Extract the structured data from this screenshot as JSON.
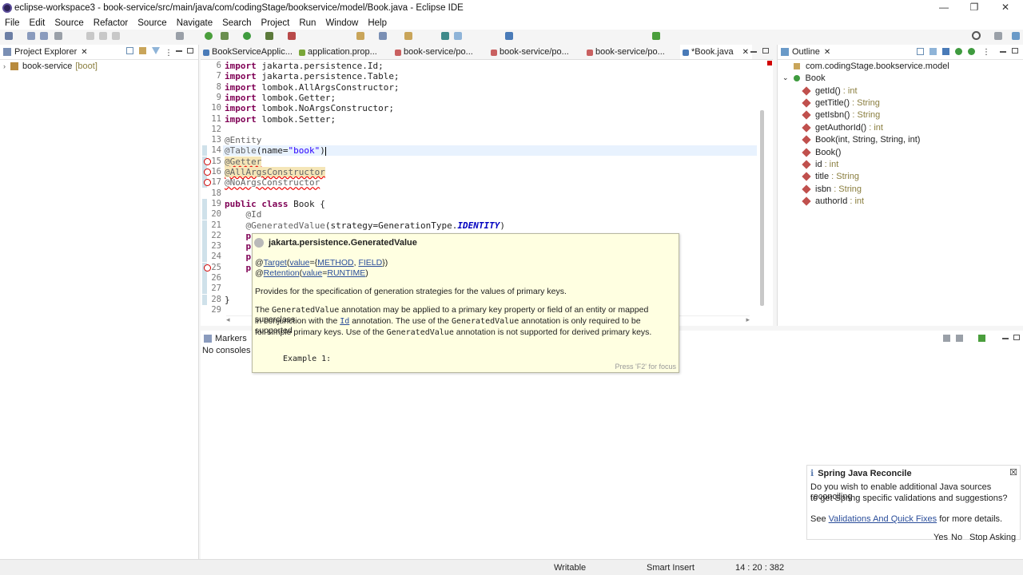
{
  "window": {
    "title": "eclipse-workspace3 - book-service/src/main/java/com/codingStage/bookservice/model/Book.java - Eclipse IDE",
    "minimize": "—",
    "maximize": "❐",
    "close": "✕"
  },
  "menu": [
    "File",
    "Edit",
    "Source",
    "Refactor",
    "Source",
    "Navigate",
    "Search",
    "Project",
    "Run",
    "Window",
    "Help"
  ],
  "project_explorer": {
    "tab": "Project Explorer",
    "project": "book-service",
    "project_tag": "[boot]"
  },
  "editor": {
    "tabs": [
      {
        "label": "BookServiceApplic...",
        "color": "#4a7bb8"
      },
      {
        "label": "application.prop...",
        "color": "#79a638"
      },
      {
        "label": "book-service/po...",
        "color": "#c96060"
      },
      {
        "label": "book-service/po...",
        "color": "#c96060"
      },
      {
        "label": "book-service/po...",
        "color": "#c96060"
      },
      {
        "label": "*Book.java",
        "color": "#4a7bb8"
      }
    ],
    "lines": [
      {
        "n": "6",
        "t": [
          {
            "k": "kw",
            "v": "import"
          },
          {
            "k": "",
            "v": " jakarta.persistence.Id;"
          }
        ]
      },
      {
        "n": "7",
        "t": [
          {
            "k": "kw",
            "v": "import"
          },
          {
            "k": "",
            "v": " jakarta.persistence.Table;"
          }
        ]
      },
      {
        "n": "8",
        "t": [
          {
            "k": "kw",
            "v": "import"
          },
          {
            "k": "",
            "v": " lombok.AllArgsConstructor;"
          }
        ]
      },
      {
        "n": "9",
        "t": [
          {
            "k": "kw",
            "v": "import"
          },
          {
            "k": "",
            "v": " lombok.Getter;"
          }
        ]
      },
      {
        "n": "10",
        "t": [
          {
            "k": "kw",
            "v": "import"
          },
          {
            "k": "",
            "v": " lombok.NoArgsConstructor;"
          }
        ]
      },
      {
        "n": "11",
        "t": [
          {
            "k": "kw",
            "v": "import"
          },
          {
            "k": "",
            "v": " lombok.Setter;"
          }
        ]
      },
      {
        "n": "12",
        "t": []
      },
      {
        "n": "13",
        "t": [
          {
            "k": "an",
            "v": "@Entity"
          }
        ]
      },
      {
        "n": "14",
        "t": [
          {
            "k": "an",
            "v": "@Table"
          },
          {
            "k": "",
            "v": "(name="
          },
          {
            "k": "str",
            "v": "\"book\""
          },
          {
            "k": "",
            "v": ")"
          }
        ]
      },
      {
        "n": "15",
        "t": [
          {
            "k": "an err warnbg",
            "v": "@Getter"
          }
        ]
      },
      {
        "n": "16",
        "t": [
          {
            "k": "an err warnbg",
            "v": "@AllArgsConstructor"
          }
        ]
      },
      {
        "n": "17",
        "t": [
          {
            "k": "an err",
            "v": "@NoArgsConstructor"
          }
        ]
      },
      {
        "n": "18",
        "t": []
      },
      {
        "n": "19",
        "t": [
          {
            "k": "kw",
            "v": "public"
          },
          {
            "k": "",
            "v": " "
          },
          {
            "k": "kw",
            "v": "class"
          },
          {
            "k": "",
            "v": " Book {"
          }
        ]
      },
      {
        "n": "20",
        "t": [
          {
            "k": "an",
            "v": "    @Id"
          }
        ]
      },
      {
        "n": "21",
        "t": [
          {
            "k": "an",
            "v": "    @GeneratedValue"
          },
          {
            "k": "",
            "v": "(strategy=GenerationType."
          },
          {
            "k": "ital",
            "v": "IDENTITY"
          },
          {
            "k": "",
            "v": ")"
          }
        ]
      },
      {
        "n": "22",
        "t": [
          {
            "k": "kw",
            "v": "    p"
          }
        ]
      },
      {
        "n": "23",
        "t": [
          {
            "k": "kw",
            "v": "    p"
          }
        ]
      },
      {
        "n": "24",
        "t": [
          {
            "k": "kw",
            "v": "    p"
          }
        ]
      },
      {
        "n": "25",
        "t": [
          {
            "k": "kw",
            "v": "    p"
          }
        ]
      },
      {
        "n": "26",
        "t": []
      },
      {
        "n": "27",
        "t": []
      },
      {
        "n": "28",
        "t": [
          {
            "k": "",
            "v": "}"
          }
        ]
      },
      {
        "n": "29",
        "t": []
      }
    ]
  },
  "outline": {
    "tab": "Outline",
    "package": "com.codingStage.bookservice.model",
    "class": "Book",
    "members": [
      {
        "name": "getId()",
        "type": ": int",
        "color": "#c0504d"
      },
      {
        "name": "getTitle()",
        "type": ": String",
        "color": "#c0504d"
      },
      {
        "name": "getIsbn()",
        "type": ": String",
        "color": "#c0504d"
      },
      {
        "name": "getAuthorId()",
        "type": ": int",
        "color": "#c0504d"
      },
      {
        "name": "Book(int, String, String, int)",
        "type": "",
        "color": "#c0504d"
      },
      {
        "name": "Book()",
        "type": "",
        "color": "#c0504d"
      },
      {
        "name": "id",
        "type": ": int",
        "color": "#c0504d"
      },
      {
        "name": "title",
        "type": ": String",
        "color": "#c0504d"
      },
      {
        "name": "isbn",
        "type": ": String",
        "color": "#c0504d"
      },
      {
        "name": "authorId",
        "type": ": int",
        "color": "#c0504d"
      }
    ]
  },
  "markers": {
    "tab": "Markers",
    "empty": "No consoles to"
  },
  "hover": {
    "title": "jakarta.persistence.GeneratedValue",
    "target_prefix": "@",
    "target": "Target",
    "target_args_open": "(",
    "target_value": "value",
    "target_eq": "={",
    "target_method": "METHOD",
    "target_sep": ", ",
    "target_field": "FIELD",
    "target_close": "})",
    "retention_prefix": "@",
    "retention": "Retention",
    "retention_open": "(",
    "retention_value": "value",
    "retention_eq": "=",
    "retention_runtime": "RUNTIME",
    "retention_close": ")",
    "desc": "Provides for the specification of generation strategies for the values of primary keys.",
    "p1_a": "The ",
    "p1_code1": "GeneratedValue",
    "p1_b": " annotation may be applied to a primary key property or field of an entity or mapped superclass",
    "p2_a": "in conjunction with the ",
    "p2_id": "Id",
    "p2_b": " annotation. The use of the ",
    "p2_code": "GeneratedValue",
    "p2_c": " annotation is only required to be supported",
    "p3_a": "for simple primary keys. Use of the ",
    "p3_code": "GeneratedValue",
    "p3_b": " annotation is not supported for derived primary keys.",
    "example": "Example 1:",
    "f2": "Press 'F2' for focus"
  },
  "notification": {
    "title": "Spring Java Reconcile",
    "body1": "Do you wish to enable additional Java sources reconciling",
    "body2": "to get Spring specific validations and suggestions?",
    "see": "See ",
    "link": "Validations And Quick Fixes",
    "more": " for more details.",
    "yes": "Yes",
    "no": "No",
    "stop": "Stop Asking"
  },
  "status": {
    "writable": "Writable",
    "insert": "Smart Insert",
    "pos": "14 : 20 : 382"
  }
}
